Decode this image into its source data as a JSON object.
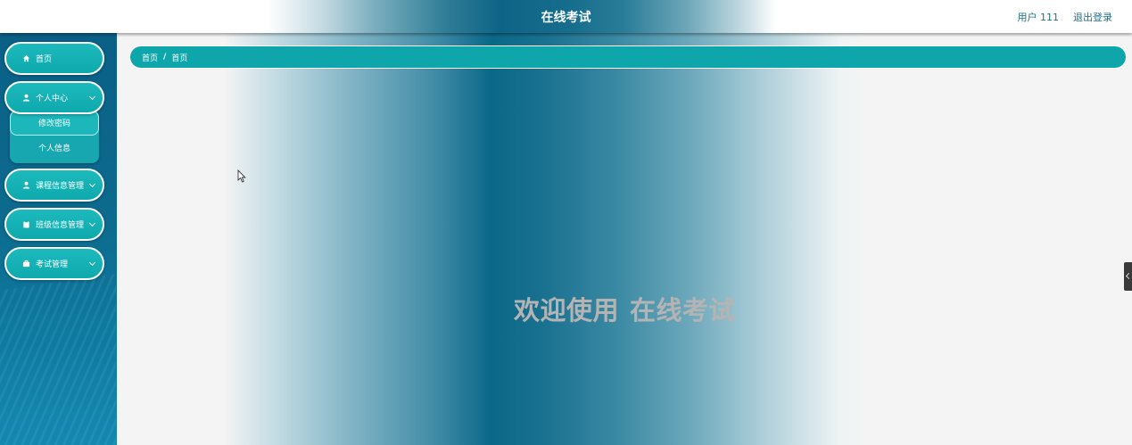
{
  "header": {
    "title": "在线考试",
    "user_label": "用户 111",
    "logout_label": "退出登录"
  },
  "sidebar": {
    "items": [
      {
        "label": "首页",
        "icon": "home-icon"
      },
      {
        "label": "个人中心",
        "icon": "user-icon",
        "expanded": true,
        "children": [
          {
            "label": "修改密码",
            "active": true
          },
          {
            "label": "个人信息"
          }
        ]
      },
      {
        "label": "课程信息管理",
        "icon": "user-icon"
      },
      {
        "label": "班级信息管理",
        "icon": "clipboard-icon"
      },
      {
        "label": "考试管理",
        "icon": "briefcase-icon"
      }
    ]
  },
  "breadcrumb": {
    "items": [
      "首页",
      "首页"
    ],
    "separator": "/"
  },
  "main": {
    "welcome_prefix": "欢迎使用",
    "welcome_name": "在线考试"
  },
  "colors": {
    "accent": "#0ea6aa",
    "sidebar": "#0b5f86",
    "header_text": "#1f6f8a",
    "welcome_text": "#b4b4b4"
  }
}
